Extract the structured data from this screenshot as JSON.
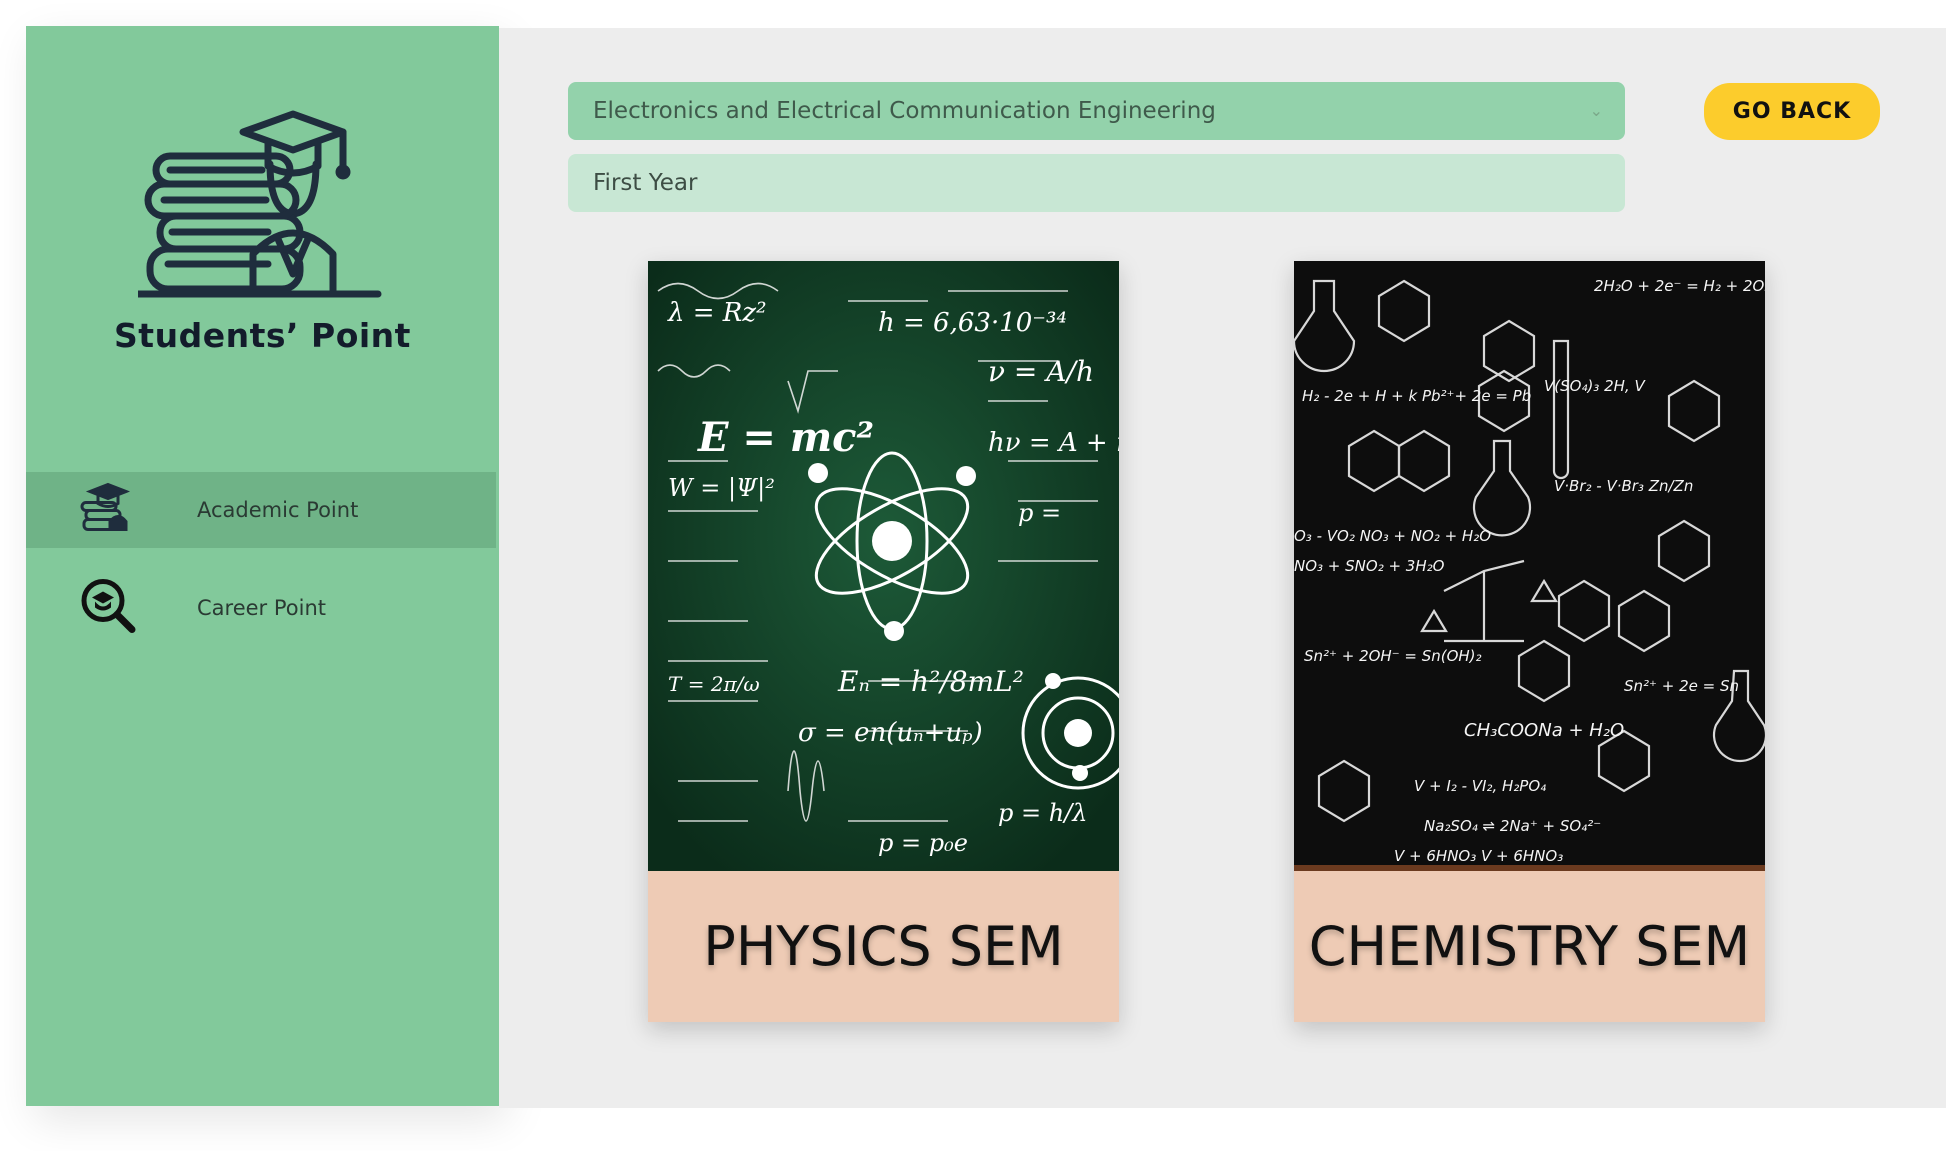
{
  "brand": {
    "name": "Students’ Point"
  },
  "sidebar": {
    "items": [
      {
        "label": "Academic Point",
        "icon": "academic-icon",
        "active": true
      },
      {
        "label": "Career Point",
        "icon": "career-search-icon",
        "active": false
      }
    ]
  },
  "filters": {
    "branch": "Electronics and Electrical Communication Engineering",
    "year": "First Year"
  },
  "actions": {
    "go_back": "GO BACK"
  },
  "cards": [
    {
      "title": "PHYSICS SEM",
      "image": "physics-chalkboard"
    },
    {
      "title": "CHEMISTRY SEM",
      "image": "chemistry-chalkboard"
    }
  ],
  "colors": {
    "sidebar": "#82c99b",
    "active_item": "#6fb387",
    "select": "#93d2ab",
    "year_field": "#c8e7d4",
    "button": "#fccc2c",
    "card_footer": "#eecbb5",
    "physics_board": "#0f3b24",
    "chemistry_board": "#0d0d0d"
  }
}
